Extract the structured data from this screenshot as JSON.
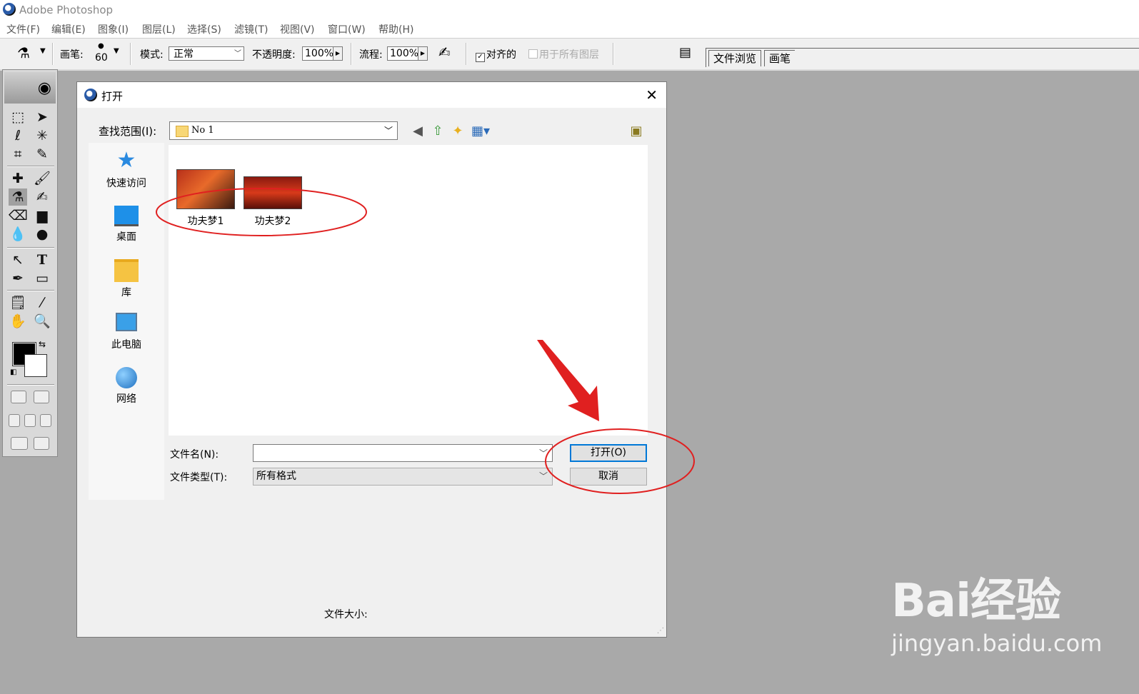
{
  "window": {
    "title": "Adobe Photoshop"
  },
  "menu": [
    "文件(F)",
    "编辑(E)",
    "图象(I)",
    "图层(L)",
    "选择(S)",
    "滤镜(T)",
    "视图(V)",
    "窗口(W)",
    "帮助(H)"
  ],
  "options": {
    "brush_label": "画笔:",
    "brush_size": "60",
    "mode_label": "模式:",
    "mode_value": "正常",
    "opacity_label": "不透明度:",
    "opacity_value": "100%",
    "flow_label": "流程:",
    "flow_value": "100%",
    "aligned_label": "对齐的",
    "aligned_checked": true,
    "all_layers_label": "用于所有图层",
    "all_layers_checked": false
  },
  "palette_tabs": [
    "文件浏览",
    "画笔"
  ],
  "dialog": {
    "title": "打开",
    "look_in_label": "查找范围(I):",
    "look_in_value": "No 1",
    "places": [
      "快速访问",
      "桌面",
      "库",
      "此电脑",
      "网络"
    ],
    "files": [
      "功夫梦1",
      "功夫梦2"
    ],
    "file_name_label": "文件名(N):",
    "file_name_value": "",
    "file_type_label": "文件类型(T):",
    "file_type_value": "所有格式",
    "open_button": "打开(O)",
    "cancel_button": "取消",
    "file_size_label": "文件大小:"
  },
  "watermark": {
    "brand": "Bai经验",
    "url": "jingyan.baidu.com"
  },
  "colors": {
    "annotation": "#e02020",
    "accent": "#0078d7",
    "workspace": "#a9a9a9"
  }
}
